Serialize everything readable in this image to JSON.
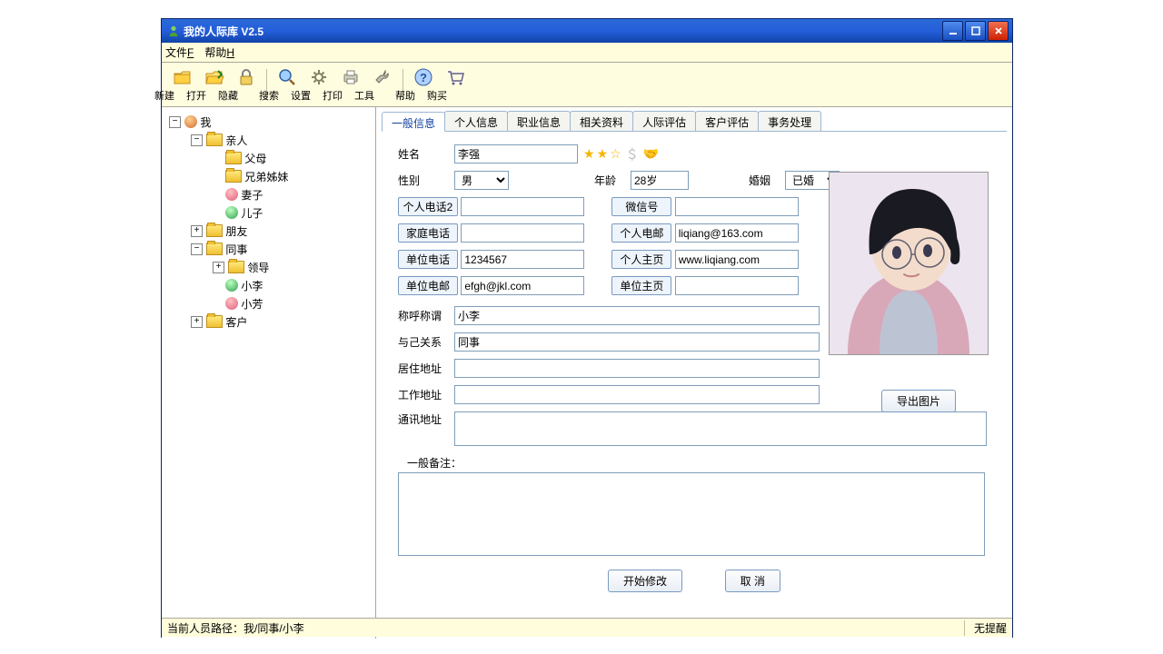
{
  "window": {
    "title": "我的人际库  V2.5"
  },
  "menubar": {
    "file": "文件",
    "file_mn": "F",
    "help": "帮助",
    "help_mn": "H"
  },
  "toolbar": {
    "new_": "新建",
    "open": "打开",
    "hide": "隐藏",
    "search": "搜索",
    "settings": "设置",
    "print": "打印",
    "tools": "工具",
    "help": "帮助",
    "buy": "购买"
  },
  "tree": {
    "me": "我",
    "family": "亲人",
    "parents": "父母",
    "siblings": "兄弟姊妹",
    "wife": "妻子",
    "son": "儿子",
    "friends": "朋友",
    "colleagues": "同事",
    "leaders": "领导",
    "xiaoli": "小李",
    "xiaofang": "小芳",
    "clients": "客户"
  },
  "tabs": [
    "一般信息",
    "个人信息",
    "职业信息",
    "相关资料",
    "人际评估",
    "客户评估",
    "事务处理"
  ],
  "form": {
    "labels": {
      "name": "姓名",
      "gender": "性别",
      "age": "年龄",
      "marriage": "婚姻",
      "phone2": "个人电话2",
      "wechat": "微信号",
      "homephone": "家庭电话",
      "email": "个人电邮",
      "workphone": "单位电话",
      "homepage": "个人主页",
      "workemail": "单位电邮",
      "workpage": "单位主页",
      "nickname": "称呼称谓",
      "relation": "与己关系",
      "homeaddr": "居住地址",
      "workaddr": "工作地址",
      "mailaddr": "通讯地址",
      "remarks": "一般备注："
    },
    "values": {
      "name": "李强",
      "gender": "男",
      "age": "28岁",
      "marriage": "已婚",
      "workphone": "1234567",
      "email": "liqiang@163.com",
      "homepage": "www.liqiang.com",
      "workemail": "efgh@jkl.com",
      "nickname": "小李",
      "relation": "同事"
    },
    "rating_stars": 2,
    "buttons": {
      "export_photo": "导出图片",
      "start_edit": "开始修改",
      "cancel": "取  消"
    }
  },
  "statusbar": {
    "path": "当前人员路径：我/同事/小李",
    "reminder": "无提醒"
  }
}
